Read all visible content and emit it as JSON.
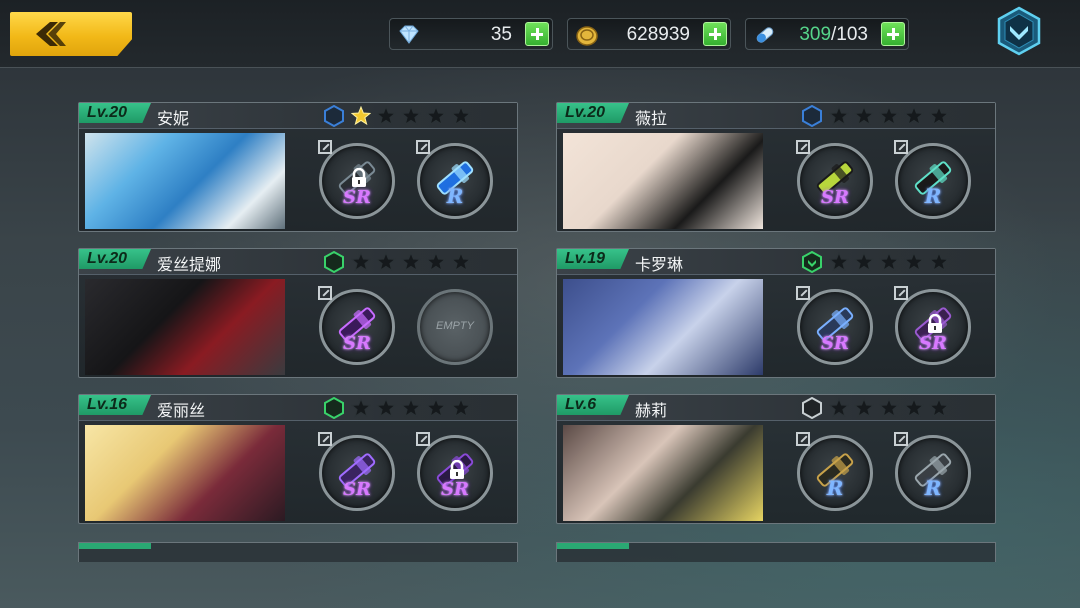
{
  "resources": {
    "gems": "35",
    "gold": "628939",
    "stamina_current": "309",
    "stamina_max": "/103"
  },
  "characters": [
    {
      "level": "Lv.20",
      "name": "安妮",
      "stars_filled": 1,
      "badge": "blue",
      "weapons": [
        {
          "rarity": "SR",
          "locked": true
        },
        {
          "rarity": "R",
          "locked": false
        }
      ]
    },
    {
      "level": "Lv.20",
      "name": "薇拉",
      "stars_filled": 0,
      "badge": "blue",
      "weapons": [
        {
          "rarity": "SR",
          "locked": false
        },
        {
          "rarity": "R",
          "locked": false
        }
      ]
    },
    {
      "level": "Lv.20",
      "name": "爱丝提娜",
      "stars_filled": 0,
      "badge": "green",
      "weapons": [
        {
          "rarity": "SR",
          "locked": false
        },
        {
          "empty": true,
          "label": "EMPTY"
        }
      ]
    },
    {
      "level": "Lv.19",
      "name": "卡罗琳",
      "stars_filled": 0,
      "badge": "green-chevron",
      "weapons": [
        {
          "rarity": "SR",
          "locked": false
        },
        {
          "rarity": "SR",
          "locked": true
        }
      ]
    },
    {
      "level": "Lv.16",
      "name": "爱丽丝",
      "stars_filled": 0,
      "badge": "green",
      "weapons": [
        {
          "rarity": "SR",
          "locked": false
        },
        {
          "rarity": "SR",
          "locked": true
        }
      ]
    },
    {
      "level": "Lv.6",
      "name": "赫莉",
      "stars_filled": 0,
      "badge": "grey",
      "weapons": [
        {
          "rarity": "R",
          "locked": false
        },
        {
          "rarity": "R",
          "locked": false
        }
      ]
    }
  ],
  "colors": {
    "accent_yellow": "#f2b918",
    "level_green": "#2aa873",
    "sr_purple": "#d879ff",
    "r_blue": "#7fb6ff"
  }
}
